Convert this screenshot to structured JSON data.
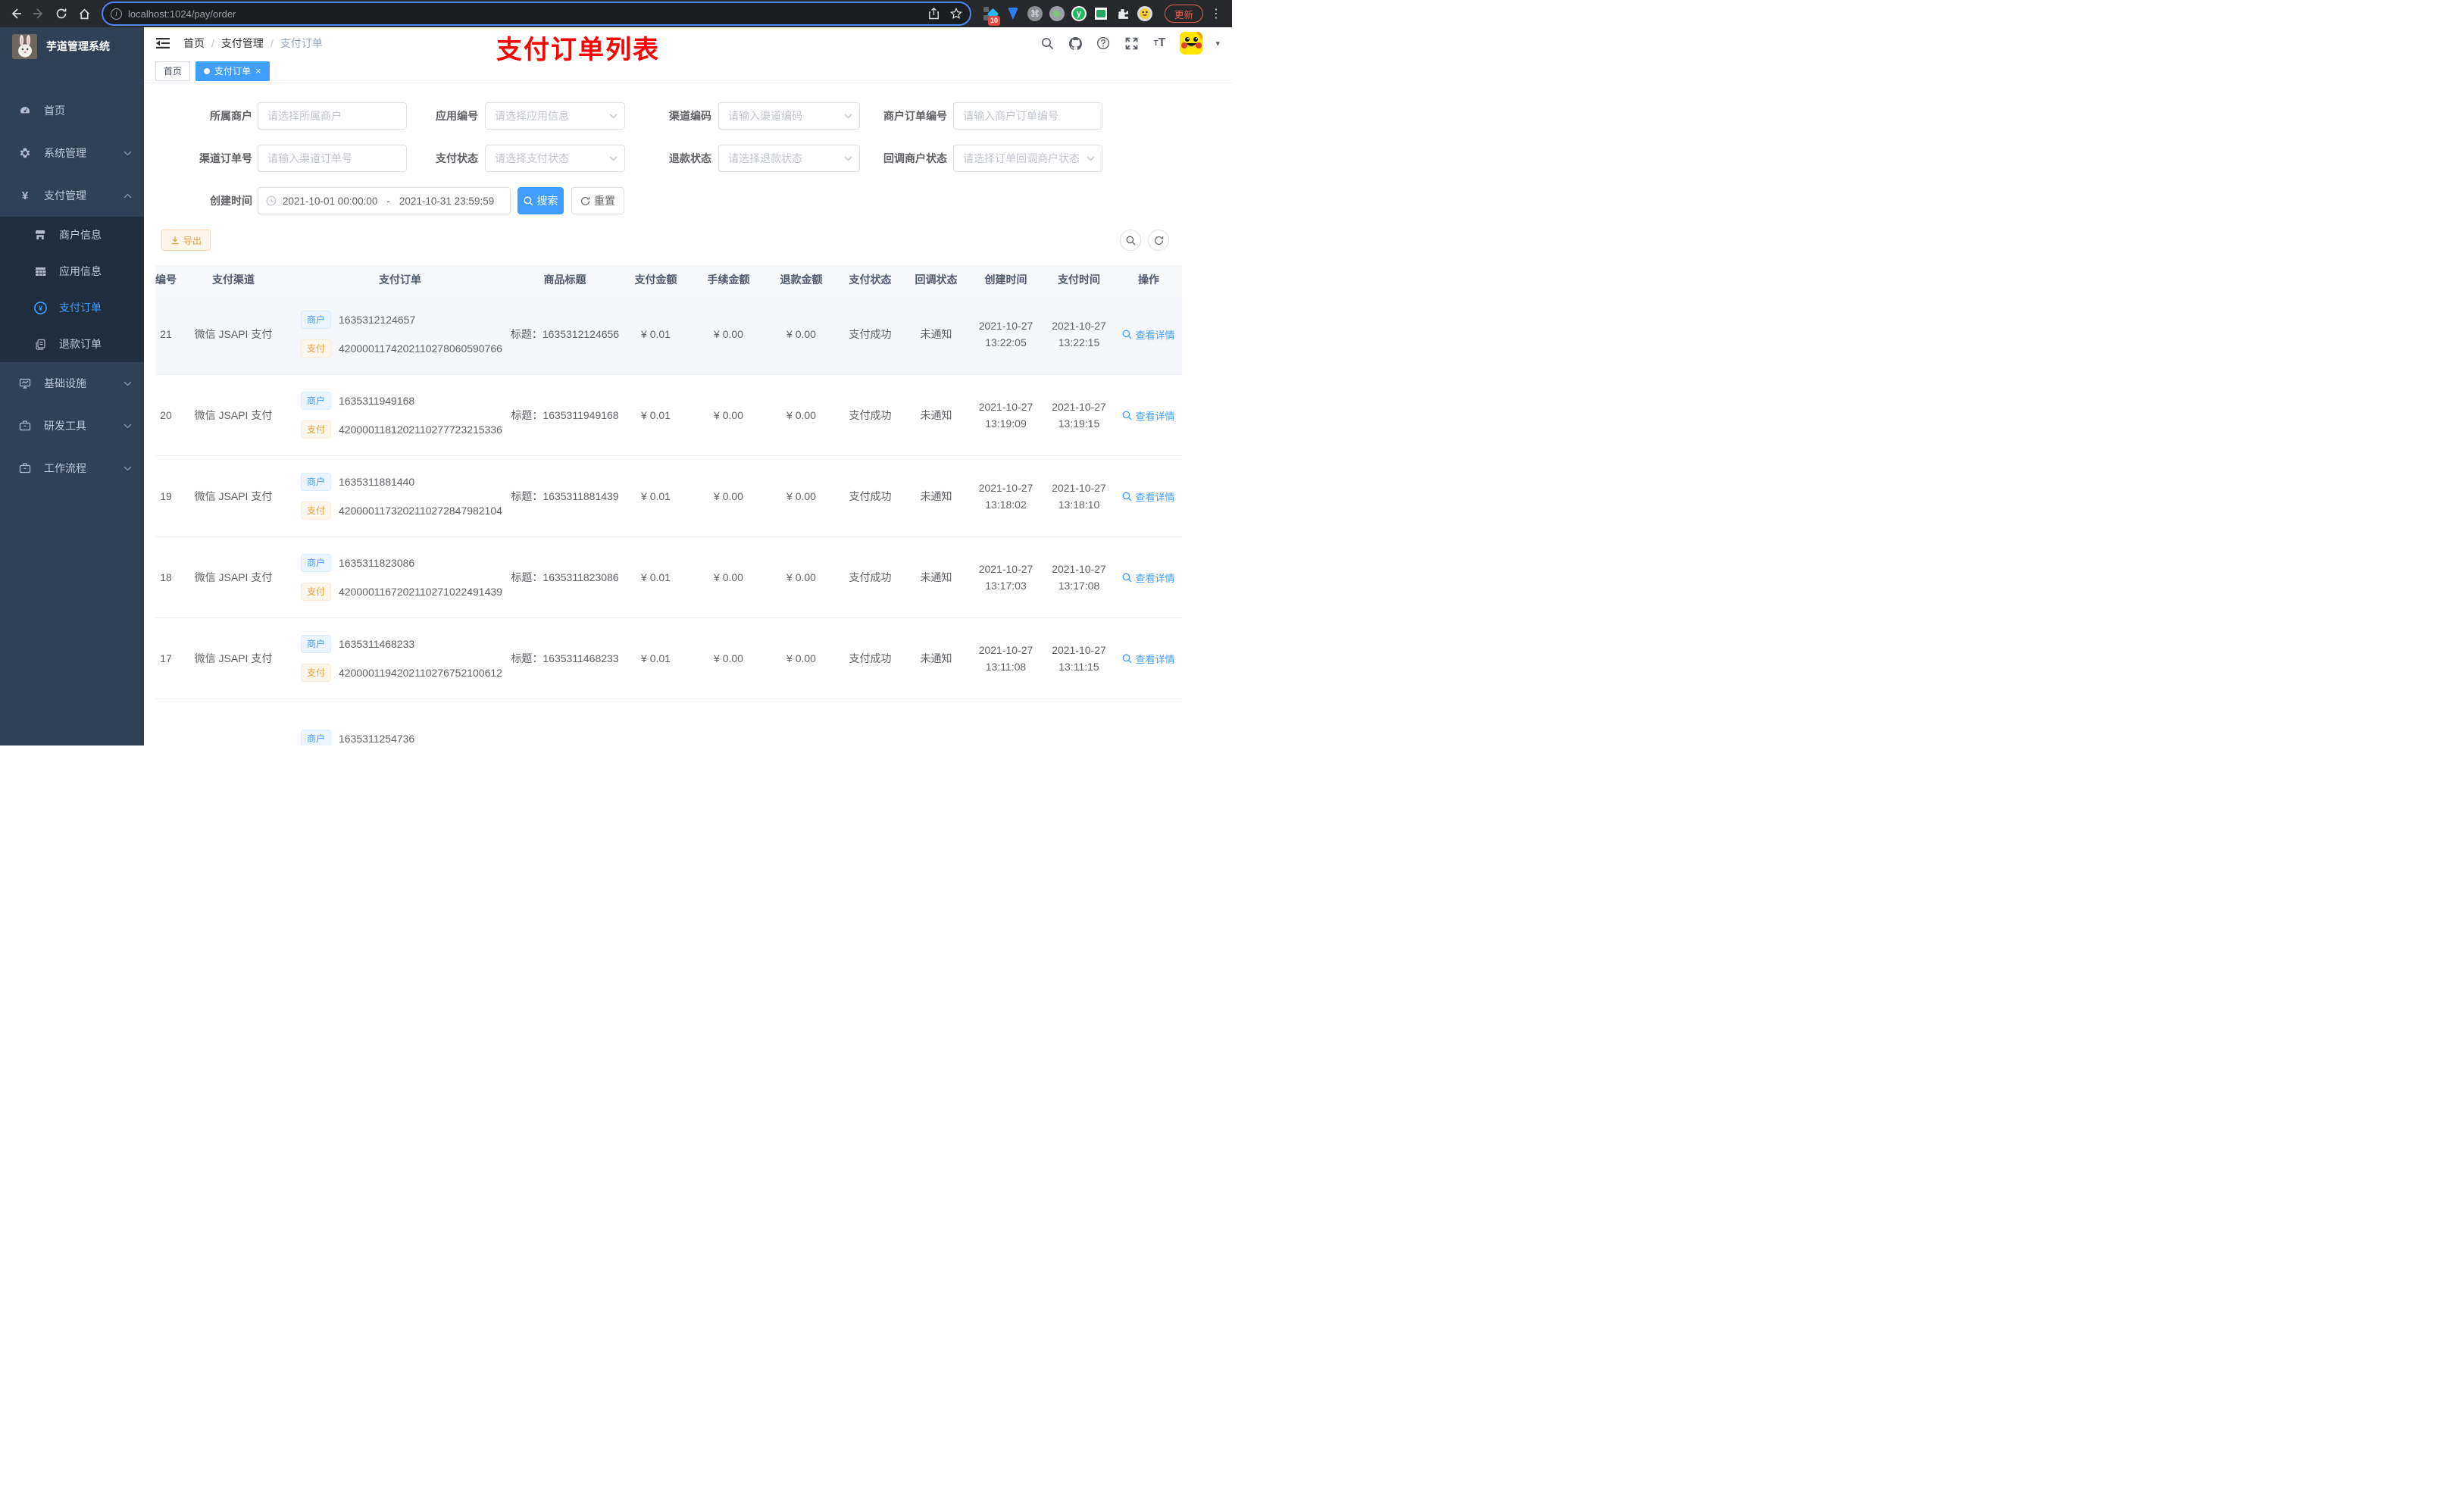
{
  "browser": {
    "url": "localhost:1024/pay/order",
    "update_label": "更新",
    "extension_badge": "10"
  },
  "sidebar": {
    "title": "芋道管理系统",
    "items": [
      {
        "label": "首页"
      },
      {
        "label": "系统管理"
      },
      {
        "label": "支付管理"
      },
      {
        "label": "商户信息"
      },
      {
        "label": "应用信息"
      },
      {
        "label": "支付订单"
      },
      {
        "label": "退款订单"
      },
      {
        "label": "基础设施"
      },
      {
        "label": "研发工具"
      },
      {
        "label": "工作流程"
      }
    ]
  },
  "navbar": {
    "breadcrumb": {
      "items": [
        "首页",
        "支付管理",
        "支付订单"
      ],
      "separator": "/"
    },
    "annotation": "支付订单列表"
  },
  "tabbar": {
    "tabs": [
      {
        "label": "首页"
      },
      {
        "label": "支付订单"
      }
    ]
  },
  "filters": {
    "fields": [
      {
        "label": "所属商户",
        "placeholder": "请选择所属商户"
      },
      {
        "label": "应用编号",
        "placeholder": "请选择应用信息"
      },
      {
        "label": "渠道编码",
        "placeholder": "请输入渠道编码"
      },
      {
        "label": "商户订单编号",
        "placeholder": "请输入商户订单编号"
      },
      {
        "label": "渠道订单号",
        "placeholder": "请输入渠道订单号"
      },
      {
        "label": "支付状态",
        "placeholder": "请选择支付状态"
      },
      {
        "label": "退款状态",
        "placeholder": "请选择退款状态"
      },
      {
        "label": "回调商户状态",
        "placeholder": "请选择订单回调商户状态"
      }
    ],
    "date": {
      "label": "创建时间",
      "start": "2021-10-01 00:00:00",
      "separator": "-",
      "end": "2021-10-31 23:59:59"
    },
    "search_label": "搜索",
    "reset_label": "重置"
  },
  "toolbar": {
    "export_label": "导出"
  },
  "table": {
    "columns": [
      "编号",
      "支付渠道",
      "支付订单",
      "商品标题",
      "支付金额",
      "手续金额",
      "退款金额",
      "支付状态",
      "回调状态",
      "创建时间",
      "支付时间",
      "操作"
    ],
    "rows": [
      {
        "id": "21",
        "channel": "微信 JSAPI 支付",
        "merchant_tag": "商户",
        "merchant_no": "1635312124657",
        "pay_tag": "支付",
        "pay_no": "4200001174202110278060590766",
        "title": "标题：1635312124656",
        "amount": "¥ 0.01",
        "fee": "¥ 0.00",
        "refund": "¥ 0.00",
        "status": "支付成功",
        "notify": "未通知",
        "create_date": "2021-10-27",
        "create_time": "13:22:05",
        "pay_date": "2021-10-27",
        "pay_time": "13:22:15",
        "action": "查看详情",
        "highlight": true
      },
      {
        "id": "20",
        "channel": "微信 JSAPI 支付",
        "merchant_tag": "商户",
        "merchant_no": "1635311949168",
        "pay_tag": "支付",
        "pay_no": "4200001181202110277723215336",
        "title": "标题：1635311949168",
        "amount": "¥ 0.01",
        "fee": "¥ 0.00",
        "refund": "¥ 0.00",
        "status": "支付成功",
        "notify": "未通知",
        "create_date": "2021-10-27",
        "create_time": "13:19:09",
        "pay_date": "2021-10-27",
        "pay_time": "13:19:15",
        "action": "查看详情"
      },
      {
        "id": "19",
        "channel": "微信 JSAPI 支付",
        "merchant_tag": "商户",
        "merchant_no": "1635311881440",
        "pay_tag": "支付",
        "pay_no": "4200001173202110272847982104",
        "title": "标题：1635311881439",
        "amount": "¥ 0.01",
        "fee": "¥ 0.00",
        "refund": "¥ 0.00",
        "status": "支付成功",
        "notify": "未通知",
        "create_date": "2021-10-27",
        "create_time": "13:18:02",
        "pay_date": "2021-10-27",
        "pay_time": "13:18:10",
        "action": "查看详情"
      },
      {
        "id": "18",
        "channel": "微信 JSAPI 支付",
        "merchant_tag": "商户",
        "merchant_no": "1635311823086",
        "pay_tag": "支付",
        "pay_no": "4200001167202110271022491439",
        "title": "标题：1635311823086",
        "amount": "¥ 0.01",
        "fee": "¥ 0.00",
        "refund": "¥ 0.00",
        "status": "支付成功",
        "notify": "未通知",
        "create_date": "2021-10-27",
        "create_time": "13:17:03",
        "pay_date": "2021-10-27",
        "pay_time": "13:17:08",
        "action": "查看详情"
      },
      {
        "id": "17",
        "channel": "微信 JSAPI 支付",
        "merchant_tag": "商户",
        "merchant_no": "1635311468233",
        "pay_tag": "支付",
        "pay_no": "4200001194202110276752100612",
        "title": "标题：1635311468233",
        "amount": "¥ 0.01",
        "fee": "¥ 0.00",
        "refund": "¥ 0.00",
        "status": "支付成功",
        "notify": "未通知",
        "create_date": "2021-10-27",
        "create_time": "13:11:08",
        "pay_date": "2021-10-27",
        "pay_time": "13:11:15",
        "action": "查看详情"
      },
      {
        "merchant_tag": "商户",
        "merchant_no": "1635311254736",
        "partial": true
      }
    ]
  }
}
